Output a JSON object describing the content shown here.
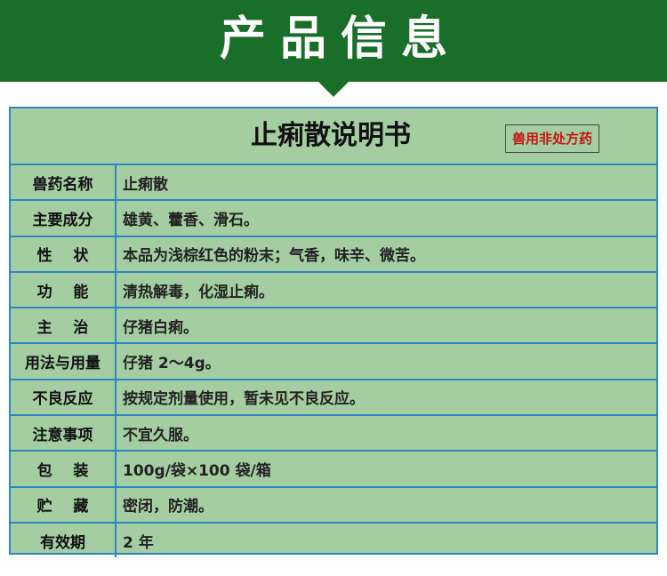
{
  "header": {
    "title": "产品信息",
    "background_color": "#196e2a",
    "title_color": "#ffffff"
  },
  "document": {
    "title": "止痢散说明书",
    "badge": "兽用非处方药",
    "badge_color": "#c41414",
    "table_background": "#a4cea2",
    "border_color": "#2b87c1"
  },
  "rows": [
    {
      "label": "兽药名称",
      "value": "止痢散"
    },
    {
      "label": "主要成分",
      "value": "雄黄、藿香、滑石。"
    },
    {
      "label": "性    状",
      "value": "本品为浅棕红色的粉末；气香，味辛、微苦。"
    },
    {
      "label": "功    能",
      "value": "清热解毒，化湿止痢。"
    },
    {
      "label": "主    治",
      "value": "仔猪白痢。"
    },
    {
      "label": "用法与用量",
      "value": "仔猪 2～4g。"
    },
    {
      "label": "不良反应",
      "value": "按规定剂量使用，暂未见不良反应。"
    },
    {
      "label": "注意事项",
      "value": "不宜久服。"
    },
    {
      "label": "包    装",
      "value": "100g/袋×100 袋/箱"
    },
    {
      "label": "贮    藏",
      "value": "密闭，防潮。"
    },
    {
      "label": "有效期",
      "value": "2 年"
    }
  ]
}
